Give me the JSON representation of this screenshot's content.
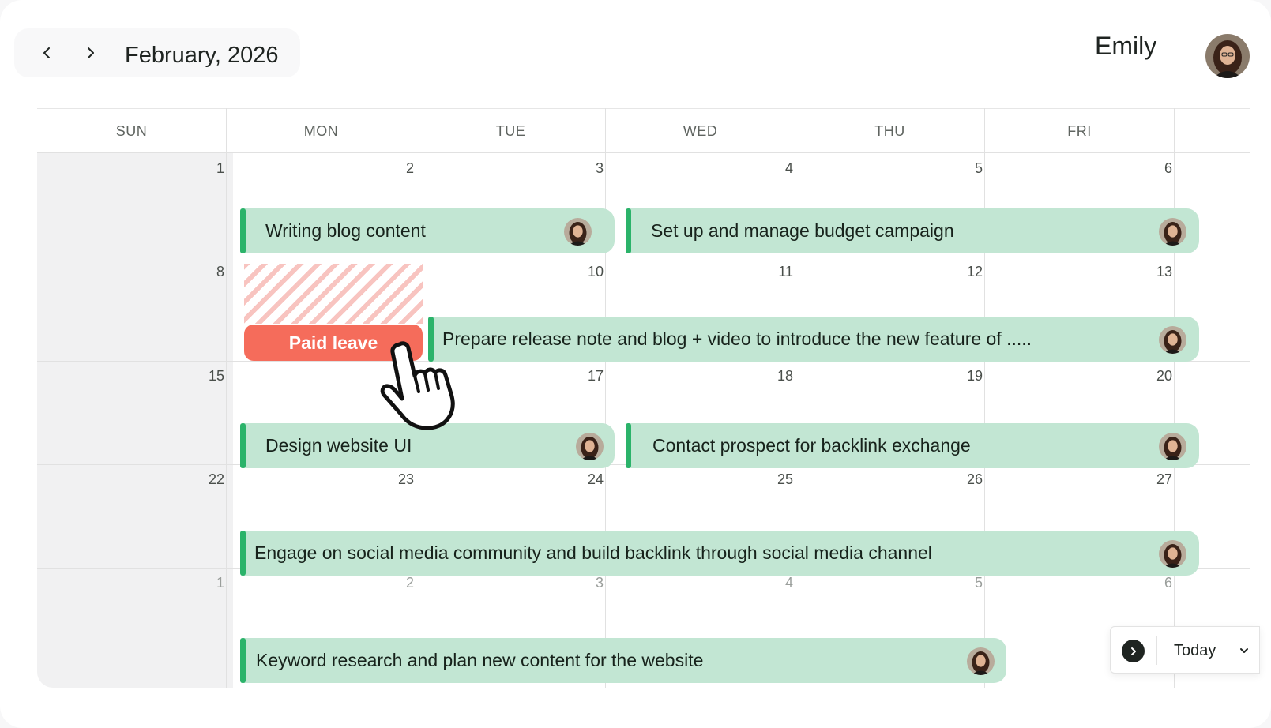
{
  "header": {
    "month_title": "February, 2026",
    "user_name": "Emily"
  },
  "weekdays": [
    "SUN",
    "MON",
    "TUE",
    "WED",
    "THU",
    "FRI"
  ],
  "weeks": [
    [
      "1",
      "2",
      "3",
      "4",
      "5",
      "6"
    ],
    [
      "8",
      "",
      "10",
      "11",
      "12",
      "13"
    ],
    [
      "15",
      "",
      "17",
      "18",
      "19",
      "20"
    ],
    [
      "22",
      "23",
      "24",
      "25",
      "26",
      "27"
    ],
    [
      "1",
      "2",
      "3",
      "4",
      "5",
      "6"
    ]
  ],
  "events": [
    {
      "title": "Writing blog content"
    },
    {
      "title": "Set up and manage budget campaign"
    },
    {
      "title": "Prepare release note and blog + video to introduce the new feature of ....."
    },
    {
      "title": "Design website UI"
    },
    {
      "title": "Contact prospect for backlink exchange"
    },
    {
      "title": "Engage on social media community and build backlink  through social media channel"
    },
    {
      "title": "Keyword research and plan new content for the website"
    }
  ],
  "leave": {
    "label": "Paid leave",
    "color": "#f56c5b"
  },
  "today_control": {
    "label": "Today"
  },
  "colors": {
    "event_bg": "#c2e6d3",
    "event_accent": "#2bb36a",
    "weekend_bg": "#f1f1f2"
  },
  "icons": {
    "prev": "chevron-left-icon",
    "next": "chevron-right-icon",
    "today_go": "chevron-right-circle-icon",
    "dropdown": "chevron-down-icon",
    "pointer": "hand-pointer-icon"
  }
}
